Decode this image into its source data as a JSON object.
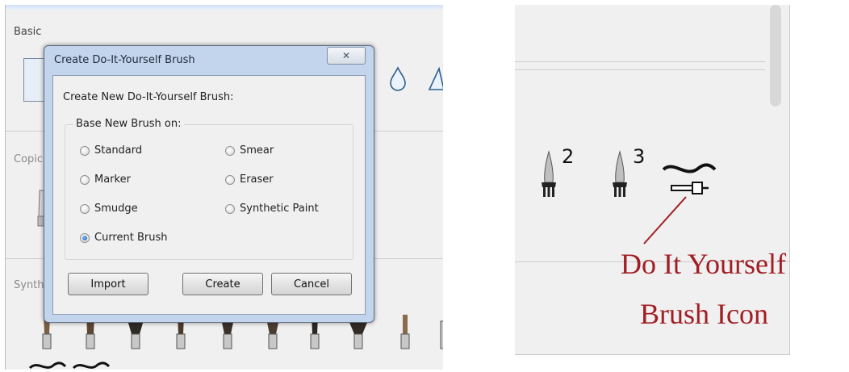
{
  "left_panel": {
    "sections": {
      "basic": "Basic",
      "copic": "Copic",
      "synthetic": "Synth"
    },
    "icons": [
      "brush-thumbnail-icon",
      "water-drop-icon",
      "triangle-icon"
    ]
  },
  "dialog": {
    "title": "Create Do-It-Yourself Brush",
    "close_glyph": "✕",
    "heading": "Create New Do-It-Yourself Brush:",
    "group_label": "Base New Brush on:",
    "options": [
      {
        "label": "Standard",
        "checked": false
      },
      {
        "label": "Smear",
        "checked": false
      },
      {
        "label": "Marker",
        "checked": false
      },
      {
        "label": "Eraser",
        "checked": false
      },
      {
        "label": "Smudge",
        "checked": false
      },
      {
        "label": "Synthetic Paint",
        "checked": false
      },
      {
        "label": "Current Brush",
        "checked": true
      }
    ],
    "buttons": {
      "import": "Import",
      "create": "Create",
      "cancel": "Cancel"
    }
  },
  "right_panel": {
    "brush_numbers": [
      "2",
      "3"
    ],
    "annotation": {
      "line1": "Do It Yourself",
      "line2": "Brush Icon",
      "color": "#a01e24"
    }
  }
}
